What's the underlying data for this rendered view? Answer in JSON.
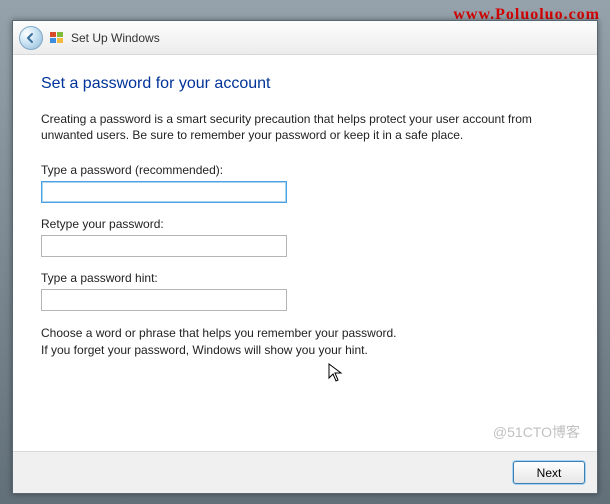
{
  "watermark_top": "www.Poluoluo.com",
  "watermark_bottom": "@51CTO博客",
  "window": {
    "title": "Set Up Windows"
  },
  "page": {
    "heading": "Set a password for your account",
    "intro": "Creating a password is a smart security precaution that helps protect your user account from unwanted users. Be sure to remember your password or keep it in a safe place.",
    "fields": {
      "password": {
        "label": "Type a password (recommended):",
        "value": ""
      },
      "retype": {
        "label": "Retype your password:",
        "value": ""
      },
      "hint": {
        "label": "Type a password hint:",
        "value": ""
      }
    },
    "hint_help_1": "Choose a word or phrase that helps you remember your password.",
    "hint_help_2": "If you forget your password, Windows will show you your hint."
  },
  "footer": {
    "next_label": "Next"
  }
}
